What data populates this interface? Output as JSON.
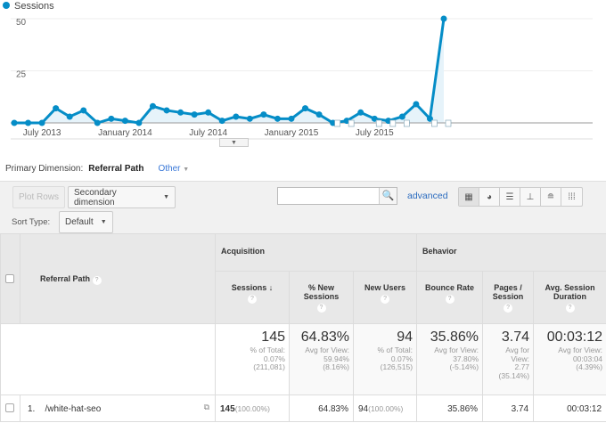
{
  "chart_data": {
    "type": "line",
    "legend": "Sessions",
    "legend_color": "#058dc7",
    "yticks": [
      25,
      50
    ],
    "ylim": [
      0,
      50
    ],
    "grid": true,
    "x": [
      "2013-05",
      "2013-06",
      "2013-07",
      "2013-08",
      "2013-09",
      "2013-10",
      "2013-11",
      "2013-12",
      "2014-01",
      "2014-02",
      "2014-03",
      "2014-04",
      "2014-05",
      "2014-06",
      "2014-07",
      "2014-08",
      "2014-09",
      "2014-10",
      "2014-11",
      "2014-12",
      "2015-01",
      "2015-02",
      "2015-03",
      "2015-04",
      "2015-05",
      "2015-06",
      "2015-07",
      "2015-08",
      "2015-09",
      "2015-10",
      "2015-11",
      "2015-12"
    ],
    "xtick_labels": [
      {
        "label": "July 2013",
        "x": "2013-07"
      },
      {
        "label": "January 2014",
        "x": "2014-01"
      },
      {
        "label": "July 2014",
        "x": "2014-07"
      },
      {
        "label": "January 2015",
        "x": "2015-01"
      },
      {
        "label": "July 2015",
        "x": "2015-07"
      }
    ],
    "series": [
      {
        "name": "Sessions",
        "values": [
          0,
          0,
          0,
          7,
          3,
          6,
          0,
          2,
          1,
          0,
          8,
          6,
          5,
          4,
          5,
          1,
          3,
          2,
          4,
          2,
          2,
          7,
          4,
          0,
          1,
          5,
          2,
          1,
          3,
          9,
          2,
          50
        ]
      }
    ]
  },
  "primary_dimension": {
    "label": "Primary Dimension:",
    "value": "Referral Path",
    "other": "Other"
  },
  "toolbar": {
    "plot_rows": "Plot Rows",
    "secondary_dimension": "Secondary dimension",
    "search_value": "",
    "advanced": "advanced",
    "sort_type_label": "Sort Type:",
    "sort_type_value": "Default",
    "view_icons": [
      "table-view-icon",
      "pie-view-icon",
      "performance-view-icon",
      "comparison-view-icon",
      "term-cloud-icon",
      "pivot-view-icon"
    ]
  },
  "table": {
    "dimension_header": "Referral Path",
    "groups": [
      "Acquisition",
      "Behavior"
    ],
    "columns": [
      "Sessions",
      "% New Sessions",
      "New Users",
      "Bounce Rate",
      "Pages / Session",
      "Avg. Session Duration"
    ],
    "totals": [
      {
        "value": "145",
        "l1": "% of Total:",
        "l2": "0.07%",
        "l3": "(211,081)"
      },
      {
        "value": "64.83%",
        "l1": "Avg for View:",
        "l2": "59.94%",
        "l3": "(8.16%)"
      },
      {
        "value": "94",
        "l1": "% of Total:",
        "l2": "0.07%",
        "l3": "(126,515)"
      },
      {
        "value": "35.86%",
        "l1": "Avg for View:",
        "l2": "37.80%",
        "l3": "(-5.14%)"
      },
      {
        "value": "3.74",
        "l1": "Avg for View:",
        "l2": "2.77",
        "l3": "(35.14%)"
      },
      {
        "value": "00:03:12",
        "l1": "Avg for View:",
        "l2": "00:03:04",
        "l3": "(4.39%)"
      }
    ],
    "rows": [
      {
        "index": "1.",
        "path": "/white-hat-seo",
        "sessions": "145",
        "sessions_pct": "(100.00%)",
        "new_sessions": "64.83%",
        "new_users": "94",
        "new_users_pct": "(100.00%)",
        "bounce": "35.86%",
        "pages": "3.74",
        "duration": "00:03:12"
      }
    ]
  }
}
